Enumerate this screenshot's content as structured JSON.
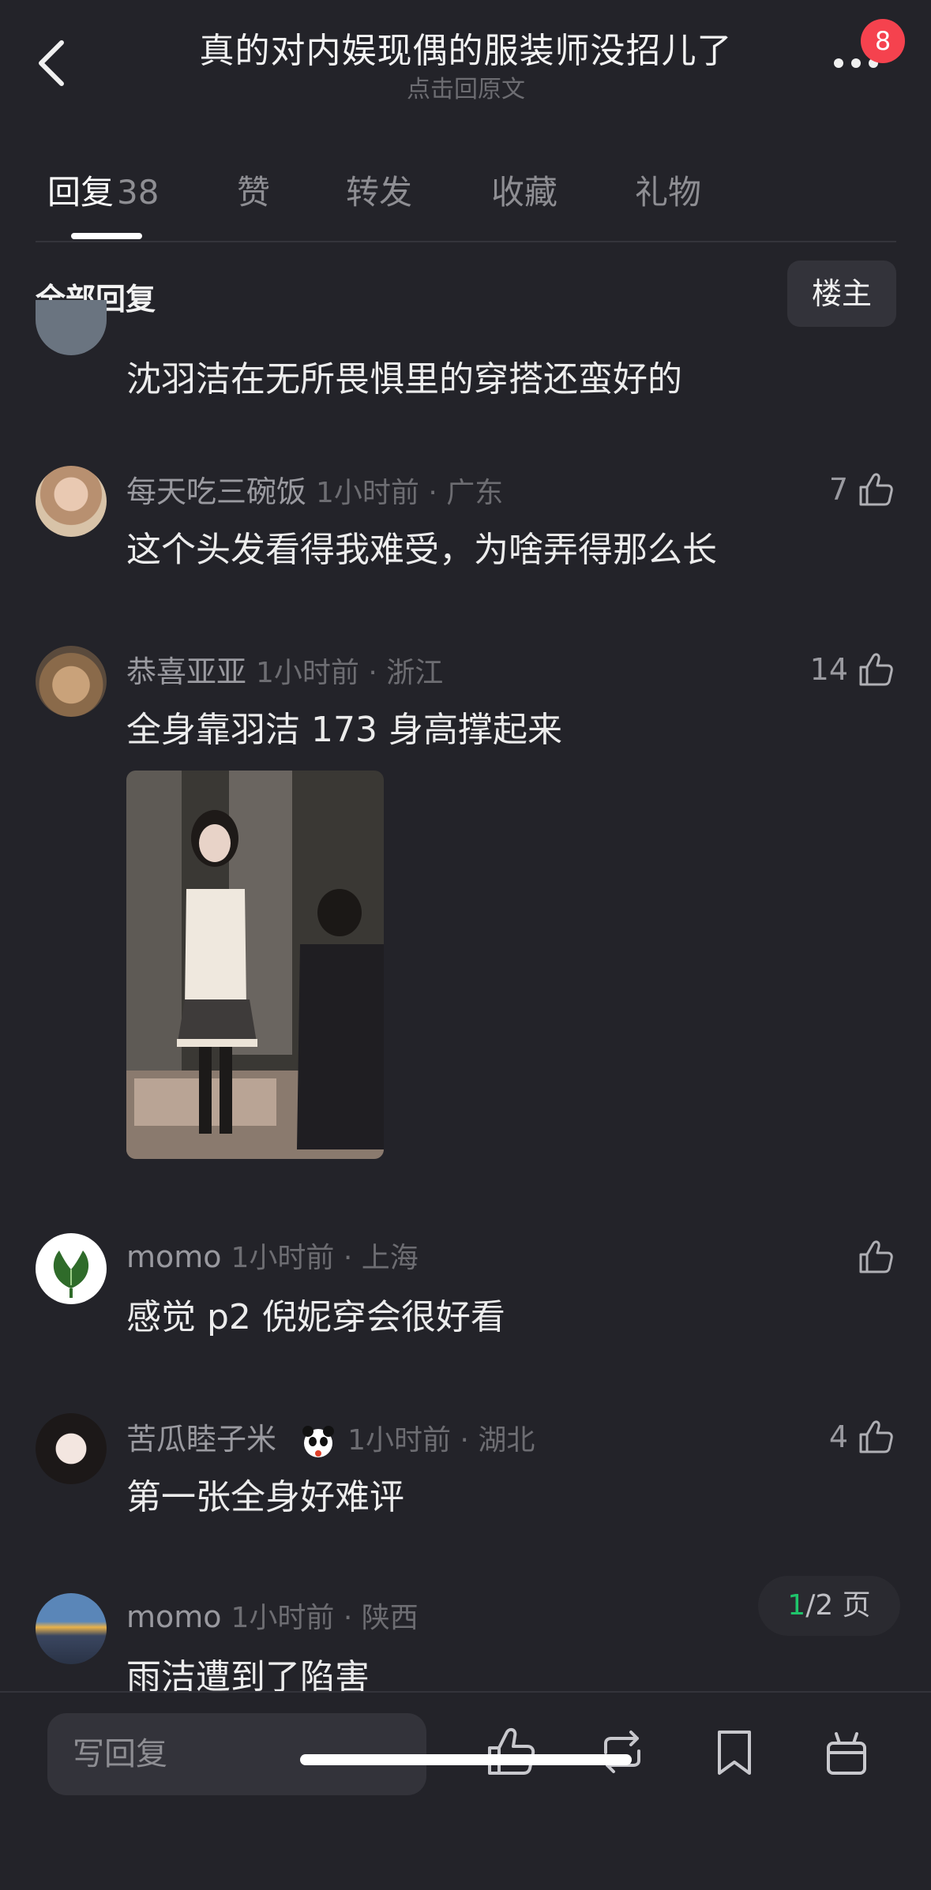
{
  "header": {
    "title": "真的对内娱现偶的服装师没招儿了",
    "subtitle": "点击回原文",
    "badge_count": "8"
  },
  "tabs": [
    {
      "label": "回复",
      "count": "38"
    },
    {
      "label": "赞"
    },
    {
      "label": "转发"
    },
    {
      "label": "收藏"
    },
    {
      "label": "礼物"
    }
  ],
  "filter": {
    "label": "全部回复",
    "op_button": "楼主"
  },
  "comments": [
    {
      "body": "沈羽洁在无所畏惧里的穿搭还蛮好的"
    },
    {
      "name": "每天吃三碗饭",
      "time": "1小时前 · 广东",
      "body": "这个头发看得我难受，为啥弄得那么长",
      "likes": "7"
    },
    {
      "name": "恭喜亚亚",
      "time": "1小时前 · 浙江",
      "body": "全身靠羽洁 173 身高撑起来",
      "likes": "14"
    },
    {
      "name": "momo",
      "time": "1小时前 · 上海",
      "body": "感觉 p2 倪妮穿会很好看",
      "likes": ""
    },
    {
      "name": "苦瓜睦子米",
      "time": "1小时前 · 湖北",
      "body": "第一张全身好难评",
      "likes": "4"
    },
    {
      "name": "momo",
      "time": "1小时前 · 陕西",
      "body": "雨洁遭到了陷害"
    }
  ],
  "pagination": {
    "current": "1",
    "rest": "/2 页"
  },
  "bottom_bar": {
    "reply_placeholder": "写回复",
    "icons": [
      "like-icon",
      "repost-icon",
      "bookmark-icon",
      "gift-icon"
    ]
  }
}
